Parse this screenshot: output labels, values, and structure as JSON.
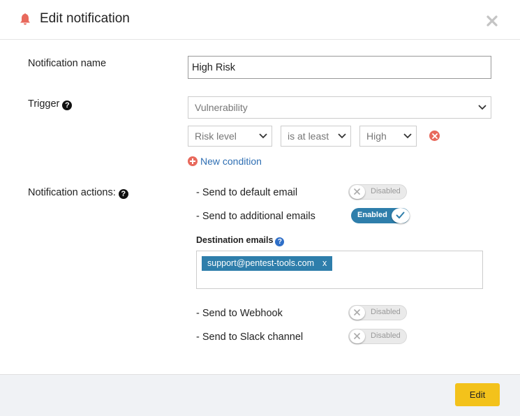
{
  "header": {
    "title": "Edit notification",
    "icon": "bell-icon",
    "close_icon": "close-icon",
    "accent": "#e8695c"
  },
  "form": {
    "name_label": "Notification name",
    "name_value": "High Risk",
    "trigger_label": "Trigger",
    "trigger_value": "Vulnerability",
    "condition": {
      "field": "Risk level",
      "operator": "is at least",
      "value": "High"
    },
    "new_condition": "New condition",
    "actions_label": "Notification actions:"
  },
  "actions": [
    {
      "label": "- Send to default email",
      "state": "Disabled",
      "enabled": false
    },
    {
      "label": "- Send to additional emails",
      "state": "Enabled",
      "enabled": true
    },
    {
      "label": "- Send to Webhook",
      "state": "Disabled",
      "enabled": false
    },
    {
      "label": "- Send to Slack channel",
      "state": "Disabled",
      "enabled": false
    }
  ],
  "destination": {
    "label": "Destination emails",
    "emails": [
      {
        "address": "support@pentest-tools.com",
        "remove": "x"
      }
    ]
  },
  "footer": {
    "edit_label": "Edit",
    "button_color": "#f3c21b"
  }
}
